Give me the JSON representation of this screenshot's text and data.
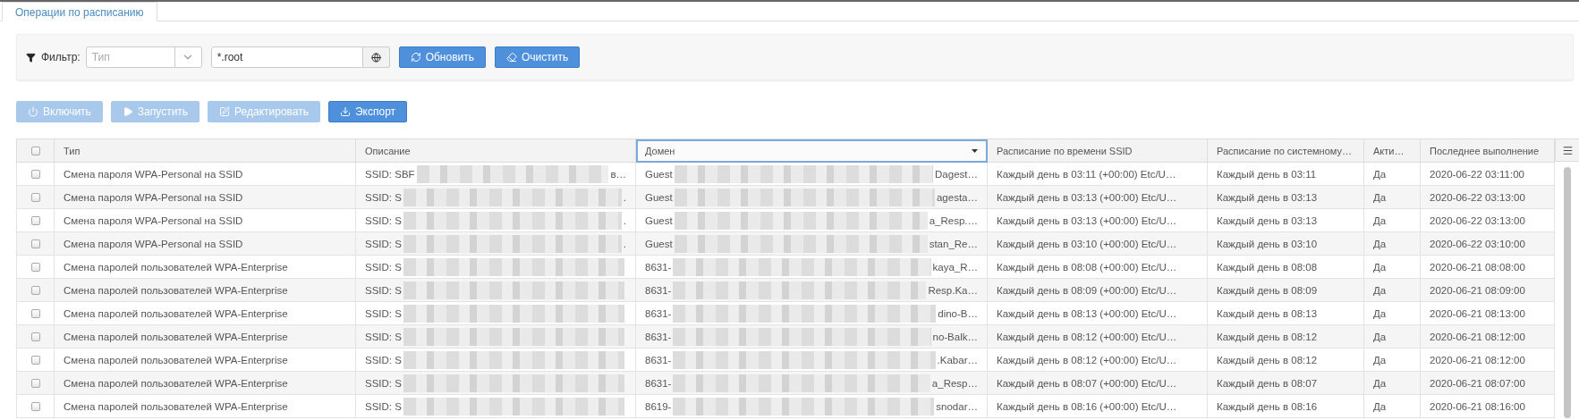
{
  "tabs": [
    {
      "label": "Операции по расписанию",
      "selected": true
    }
  ],
  "filter": {
    "label": "Фильтр:",
    "type_placeholder": "Тип",
    "domain_value": "*.root",
    "buttons": [
      {
        "label": "Обновить"
      },
      {
        "label": "Очистить"
      }
    ]
  },
  "actions": [
    {
      "label": "Включить",
      "disabled": true
    },
    {
      "label": "Запустить",
      "disabled": true
    },
    {
      "label": "Редактировать",
      "disabled": true
    },
    {
      "label": "Экспорт",
      "disabled": false
    }
  ],
  "table": {
    "all_checked": false,
    "columns": [
      {
        "label": "Тип",
        "selected": false
      },
      {
        "label": "Описание",
        "selected": false
      },
      {
        "label": "Домен",
        "selected": true
      },
      {
        "label": "Расписание по времени SSID",
        "selected": false
      },
      {
        "label": "Расписание по системному…",
        "selected": false
      },
      {
        "label": "Акти…",
        "selected": false
      },
      {
        "label": "Последнее выполнение",
        "selected": false
      }
    ],
    "rows": [
      {
        "checked": false,
        "type": "Смена пароля WPA-Personal на SSID",
        "description": {
          "start": "SSID: SBF",
          "end": "в…"
        },
        "domain": {
          "start": "Guest",
          "end": "Dagest…"
        },
        "ssid_schedule": "Каждый день в 03:11 (+00:00) Etc/U…",
        "system_schedule": "Каждый день в 03:11",
        "active": "Да",
        "last_run": "2020-06-22 03:11:00"
      },
      {
        "checked": false,
        "type": "Смена пароля WPA-Personal на SSID",
        "description": {
          "start": "SSID: S",
          "end": "."
        },
        "domain": {
          "start": "Guest",
          "end": "agesta…"
        },
        "ssid_schedule": "Каждый день в 03:13 (+00:00) Etc/U…",
        "system_schedule": "Каждый день в 03:13",
        "active": "Да",
        "last_run": "2020-06-22 03:13:00"
      },
      {
        "checked": false,
        "type": "Смена пароля WPA-Personal на SSID",
        "description": {
          "start": "SSID: S",
          "end": "."
        },
        "domain": {
          "start": "Guest",
          "end": "a_Resp.…"
        },
        "ssid_schedule": "Каждый день в 03:13 (+00:00) Etc/U…",
        "system_schedule": "Каждый день в 03:13",
        "active": "Да",
        "last_run": "2020-06-22 03:13:00"
      },
      {
        "checked": false,
        "type": "Смена пароля WPA-Personal на SSID",
        "description": {
          "start": "SSID: S",
          "end": "."
        },
        "domain": {
          "start": "Guest",
          "end": "stan_Re…"
        },
        "ssid_schedule": "Каждый день в 03:10 (+00:00) Etc/U…",
        "system_schedule": "Каждый день в 03:10",
        "active": "Да",
        "last_run": "2020-06-22 03:10:00"
      },
      {
        "checked": false,
        "type": "Смена паролей пользователей WPA-Enterprise",
        "description": {
          "start": "SSID: S"
        },
        "domain": {
          "start": "8631-",
          "end": "kaya_R…"
        },
        "ssid_schedule": "Каждый день в 08:08 (+00:00) Etc/U…",
        "system_schedule": "Каждый день в 08:08",
        "active": "Да",
        "last_run": "2020-06-21 08:08:00"
      },
      {
        "checked": false,
        "type": "Смена паролей пользователей WPA-Enterprise",
        "description": {
          "start": "SSID: S"
        },
        "domain": {
          "start": "8631-",
          "end": "Resp.Ka…"
        },
        "ssid_schedule": "Каждый день в 08:09 (+00:00) Etc/U…",
        "system_schedule": "Каждый день в 08:09",
        "active": "Да",
        "last_run": "2020-06-21 08:09:00"
      },
      {
        "checked": false,
        "type": "Смена паролей пользователей WPA-Enterprise",
        "description": {
          "start": "SSID: S"
        },
        "domain": {
          "start": "8631-",
          "end": "dino-B…"
        },
        "ssid_schedule": "Каждый день в 08:13 (+00:00) Etc/U…",
        "system_schedule": "Каждый день в 08:13",
        "active": "Да",
        "last_run": "2020-06-21 08:13:00"
      },
      {
        "checked": false,
        "type": "Смена паролей пользователей WPA-Enterprise",
        "description": {
          "start": "SSID: S"
        },
        "domain": {
          "start": "8631-",
          "end": "no-Balk…"
        },
        "ssid_schedule": "Каждый день в 08:12 (+00:00) Etc/U…",
        "system_schedule": "Каждый день в 08:12",
        "active": "Да",
        "last_run": "2020-06-21 08:12:00"
      },
      {
        "checked": false,
        "type": "Смена паролей пользователей WPA-Enterprise",
        "description": {
          "start": "SSID: S"
        },
        "domain": {
          "start": "8631-",
          "end": ".Kabar…"
        },
        "ssid_schedule": "Каждый день в 08:12 (+00:00) Etc/U…",
        "system_schedule": "Каждый день в 08:12",
        "active": "Да",
        "last_run": "2020-06-21 08:12:00"
      },
      {
        "checked": false,
        "type": "Смена паролей пользователей WPA-Enterprise",
        "description": {
          "start": "SSID: S"
        },
        "domain": {
          "start": "8631-",
          "end": "a_Resp…"
        },
        "ssid_schedule": "Каждый день в 08:07 (+00:00) Etc/U…",
        "system_schedule": "Каждый день в 08:07",
        "active": "Да",
        "last_run": "2020-06-21 08:07:00"
      },
      {
        "checked": false,
        "type": "Смена паролей пользователей WPA-Enterprise",
        "description": {
          "start": "SSID: S"
        },
        "domain": {
          "start": "8619-",
          "end": "snodar…"
        },
        "ssid_schedule": "Каждый день в 08:16 (+00:00) Etc/U…",
        "system_schedule": "Каждый день в 08:16",
        "active": "Да",
        "last_run": "2020-06-21 08:16:00"
      }
    ]
  }
}
